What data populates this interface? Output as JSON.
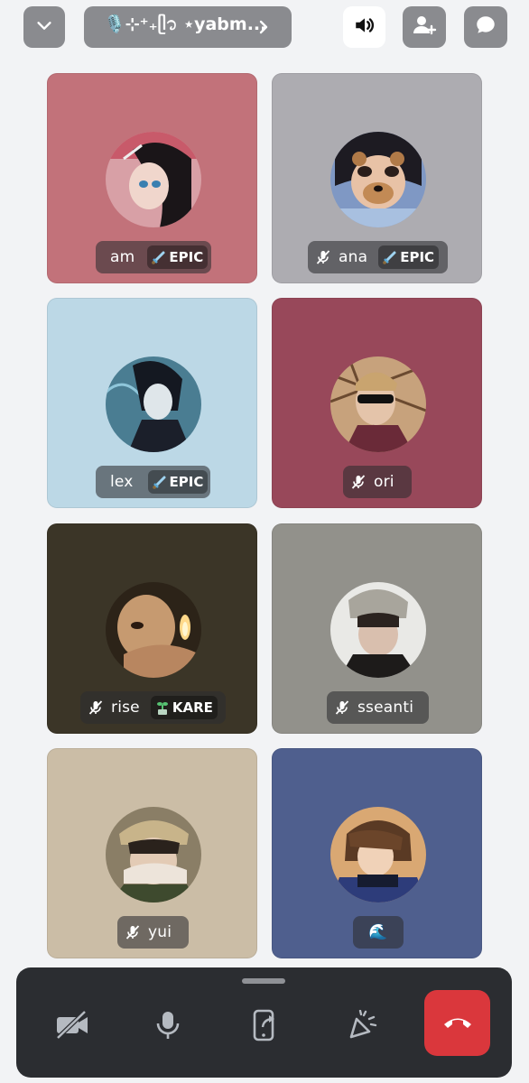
{
  "topbar": {
    "channel_name": "🎙️⊹⁺₊ᥫ᭡ ⋆yabm...",
    "colors": {
      "button_bg": "#8a8b8f",
      "speaker_bg": "#ffffff"
    },
    "icons": [
      "chevron-down-icon",
      "chevron-right-icon",
      "speaker-icon",
      "add-user-icon",
      "chat-bubble-icon"
    ]
  },
  "participants": [
    {
      "name": "am",
      "muted": false,
      "badge": "EPIC",
      "badge_icon": "sword-icon",
      "tile_color": "#c2727a"
    },
    {
      "name": "ana",
      "muted": true,
      "badge": "EPIC",
      "badge_icon": "sword-icon",
      "tile_color": "#adacb1"
    },
    {
      "name": "lex",
      "muted": false,
      "badge": "EPIC",
      "badge_icon": "sword-icon",
      "tile_color": "#bcd8e6"
    },
    {
      "name": "ori",
      "muted": true,
      "badge": "",
      "badge_icon": "",
      "tile_color": "#98485a"
    },
    {
      "name": "rise",
      "muted": true,
      "badge": "KARE",
      "badge_icon": "sprout-icon",
      "tile_color": "#3b3527"
    },
    {
      "name": "sseanti",
      "muted": true,
      "badge": "",
      "badge_icon": "",
      "tile_color": "#92918b"
    },
    {
      "name": "yui",
      "muted": true,
      "badge": "",
      "badge_icon": "",
      "tile_color": "#cbbda6"
    },
    {
      "name": "🌊",
      "muted": false,
      "badge": "",
      "badge_icon": "",
      "tile_color": "#4f5f8e"
    }
  ],
  "controls": {
    "icons": [
      "camera-off-icon",
      "microphone-icon",
      "screen-share-icon",
      "soundboard-icon",
      "end-call-icon"
    ],
    "colors": {
      "bar_bg": "#2b2d31",
      "end_call": "#da373c"
    }
  }
}
